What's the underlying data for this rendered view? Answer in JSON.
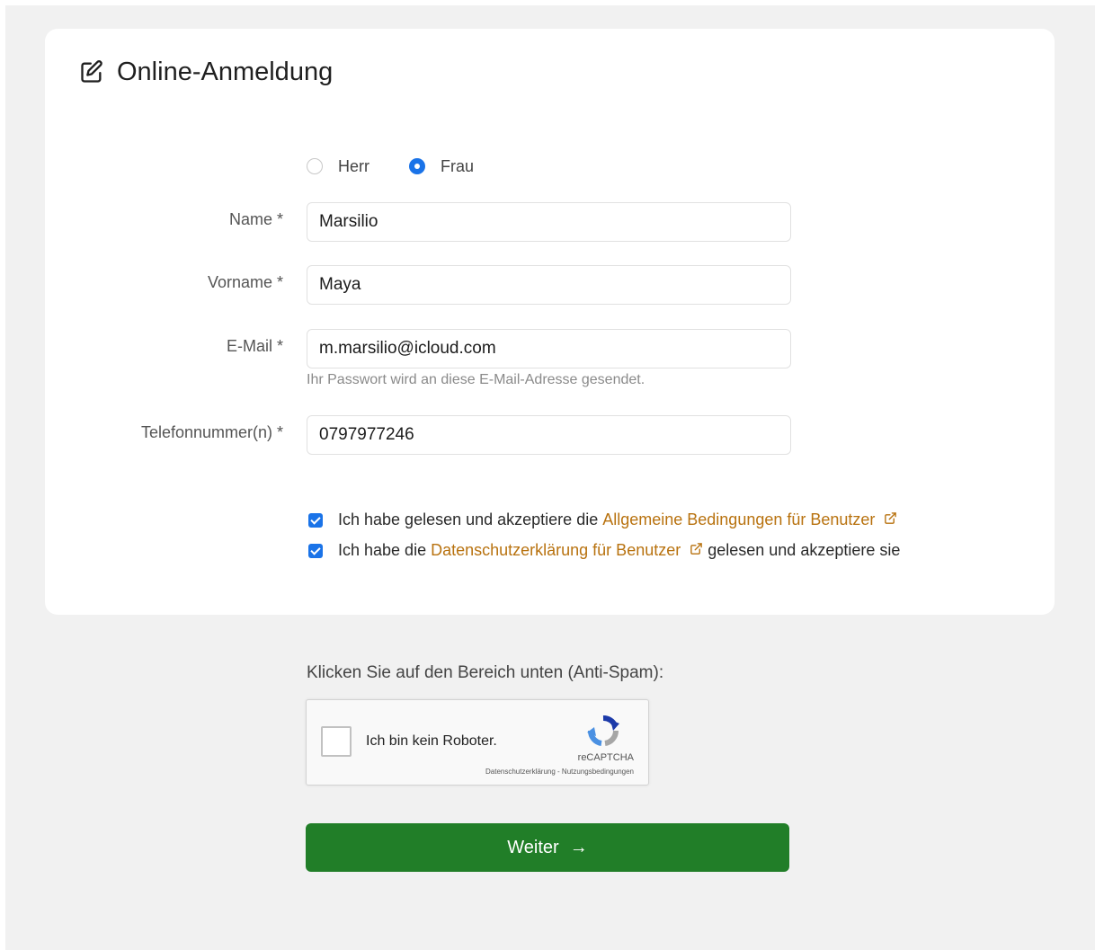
{
  "header": {
    "title": "Online-Anmeldung",
    "icon": "edit-icon"
  },
  "salutation": {
    "options": [
      {
        "label": "Herr",
        "checked": false
      },
      {
        "label": "Frau",
        "checked": true
      }
    ]
  },
  "fields": {
    "name": {
      "label": "Name *",
      "value": "Marsilio"
    },
    "vorname": {
      "label": "Vorname *",
      "value": "Maya"
    },
    "email": {
      "label": "E-Mail *",
      "value": "m.marsilio@icloud.com",
      "hint": "Ihr Passwort wird an diese E-Mail-Adresse gesendet."
    },
    "phone": {
      "label": "Telefonnummer(n) *",
      "value": "0797977246"
    }
  },
  "consents": {
    "terms": {
      "checked": true,
      "prefix": "Ich habe gelesen und akzeptiere die",
      "link": "Allgemeine Bedingungen für Benutzer"
    },
    "privacy": {
      "checked": true,
      "prefix": "Ich habe die",
      "link": "Datenschutzerklärung für Benutzer",
      "suffix": "gelesen und akzeptiere sie"
    }
  },
  "captcha": {
    "instruction": "Klicken Sie auf den Bereich unten (Anti-Spam):",
    "checkbox_label": "Ich bin kein Roboter.",
    "brand": "reCAPTCHA",
    "links": "Datenschutzerklärung - Nutzungsbedingungen"
  },
  "submit": {
    "label": "Weiter",
    "arrow": "→"
  },
  "colors": {
    "accent": "#1a73e8",
    "link": "#b8720f",
    "submit": "#217e28",
    "page_bg": "#f1f1f1"
  }
}
